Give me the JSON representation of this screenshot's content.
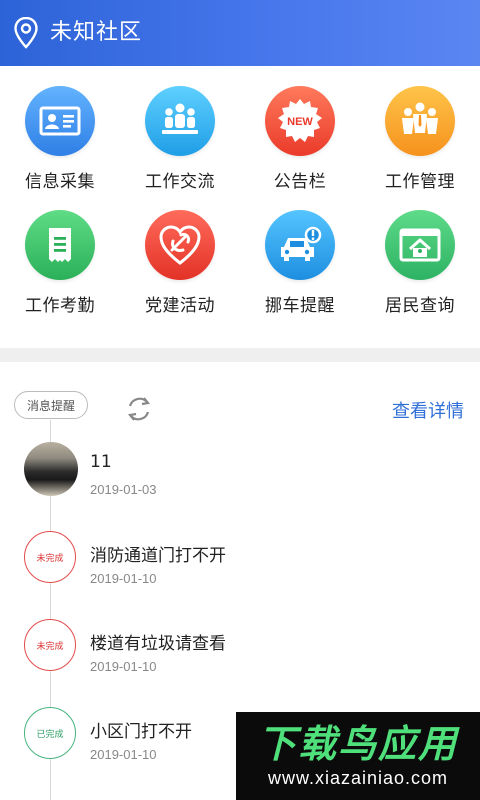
{
  "header": {
    "title": "未知社区",
    "icon": "location-pin-icon",
    "bg_from": "#2d63d8",
    "bg_to": "#5a86f2"
  },
  "grid": {
    "items": [
      {
        "label": "信息采集",
        "icon": "id-card-icon",
        "color": "#3b8ff0"
      },
      {
        "label": "工作交流",
        "icon": "people-group-icon",
        "color": "#2fb4ee"
      },
      {
        "label": "公告栏",
        "icon": "new-badge-icon",
        "badge_text": "NEW",
        "color": "#f0553a"
      },
      {
        "label": "工作管理",
        "icon": "team-manage-icon",
        "color": "#f7a423"
      },
      {
        "label": "工作考勤",
        "icon": "document-list-icon",
        "color": "#3cc266"
      },
      {
        "label": "党建活动",
        "icon": "party-emblem-icon",
        "color": "#ee4a3c"
      },
      {
        "label": "挪车提醒",
        "icon": "car-alert-icon",
        "color": "#2a9fe6"
      },
      {
        "label": "居民查询",
        "icon": "house-window-icon",
        "color": "#3fbf69"
      }
    ]
  },
  "messages": {
    "tag": "消息提醒",
    "detail_link": "查看详情",
    "items": [
      {
        "title": "11",
        "date": "2019-01-03",
        "thumb": "photo"
      },
      {
        "title": "消防通道门打不开",
        "date": "2019-01-10",
        "stamp": "未完成",
        "status": "pending"
      },
      {
        "title": "楼道有垃圾请查看",
        "date": "2019-01-10",
        "stamp": "未完成",
        "status": "pending"
      },
      {
        "title": "小区门打不开",
        "date": "2019-01-10",
        "stamp": "已完成",
        "status": "done"
      }
    ]
  },
  "watermark": {
    "brand": "下载鸟应用",
    "url": "www.xiazainiao.com"
  }
}
